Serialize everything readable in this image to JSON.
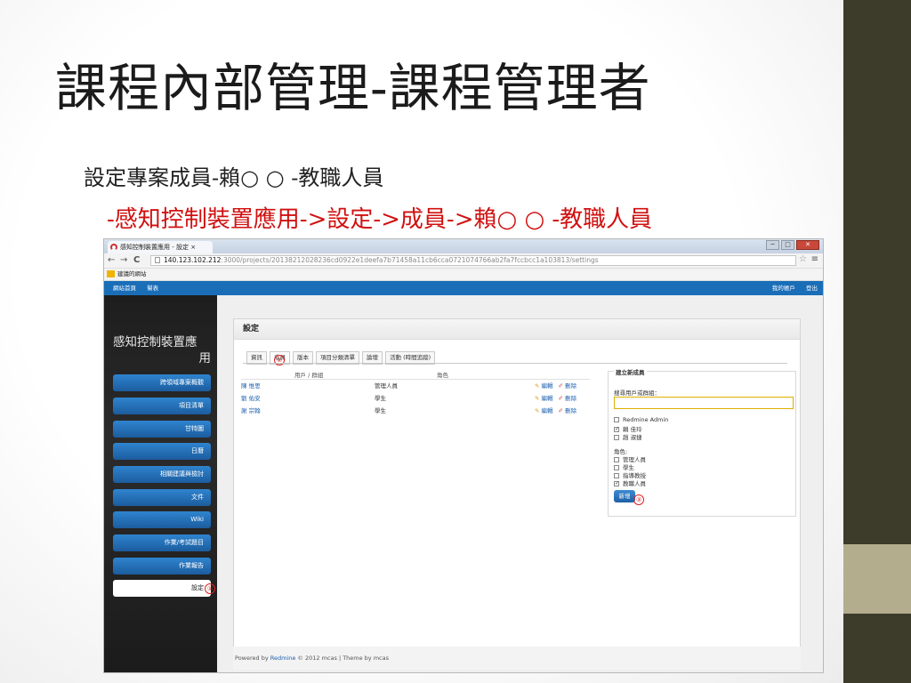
{
  "slide": {
    "title": "課程內部管理-課程管理者",
    "subtitle": "設定專案成員-賴○ ○ -教職人員",
    "path_instruction": "-感知控制裝置應用->設定->成員->賴○ ○ -教職人員"
  },
  "browser": {
    "tab_title": "感知控制裝置應用 - 設定 ×",
    "url_host": "140.123.102.212",
    "url_rest": ":3000/projects/20138212028236cd0922e1deefa7b71458a11cb6cca0721074766ab2fa7fccbcc1a103813/settings",
    "bookmark": "建議的網站",
    "window_controls": [
      "─",
      "□",
      "✕"
    ]
  },
  "app": {
    "topnav_left": [
      "網站首頁",
      "幫表"
    ],
    "topnav_right": [
      "我的帳戶",
      "登出"
    ],
    "project_name_line1": "感知控制裝置應",
    "project_name_line2": "用",
    "menu_items": [
      "跨領域專案概觀",
      "項目清單",
      "甘特圖",
      "日曆",
      "相關建議與檢討",
      "文件",
      "Wiki",
      "作業/考試題目",
      "作業報告",
      "設定"
    ],
    "content_title": "設定",
    "settings_tabs": [
      "資訊",
      "成員",
      "版本",
      "項目分類清單",
      "論壇",
      "活動 (時間追蹤)"
    ],
    "members_header": {
      "user": "用戶 / 群組",
      "role": "角色"
    },
    "members": [
      {
        "name": "陳 惟思",
        "role": "管理人員"
      },
      {
        "name": "劉 佑安",
        "role": "學生"
      },
      {
        "name": "謝 宗翰",
        "role": "學生"
      }
    ],
    "action_edit": "編輯",
    "action_delete": "刪除",
    "new_member": {
      "legend": "建立新成員",
      "search_label": "搜尋用戶或群組：",
      "users": [
        {
          "label": "Redmine Admin",
          "checked": false
        },
        {
          "label": "賴 佳玲",
          "checked": true
        },
        {
          "label": "趙 淑捷",
          "checked": false
        }
      ],
      "roles_label": "角色:",
      "roles": [
        {
          "label": "管理人員",
          "checked": false
        },
        {
          "label": "學生",
          "checked": false
        },
        {
          "label": "指導教授",
          "checked": false
        },
        {
          "label": "教職人員",
          "checked": true
        }
      ],
      "add_button": "新增"
    },
    "callouts": [
      "①",
      "②",
      "③"
    ],
    "footer": {
      "prefix": "Powered by ",
      "link": "Redmine",
      "suffix": " © 2012 mcas | Theme by mcas"
    }
  },
  "colors": {
    "sidebar_right": "#3d3b2a",
    "accent_block": "#b4ad8d",
    "topnav": "#1a6eb8",
    "path_red": "#d01010"
  }
}
